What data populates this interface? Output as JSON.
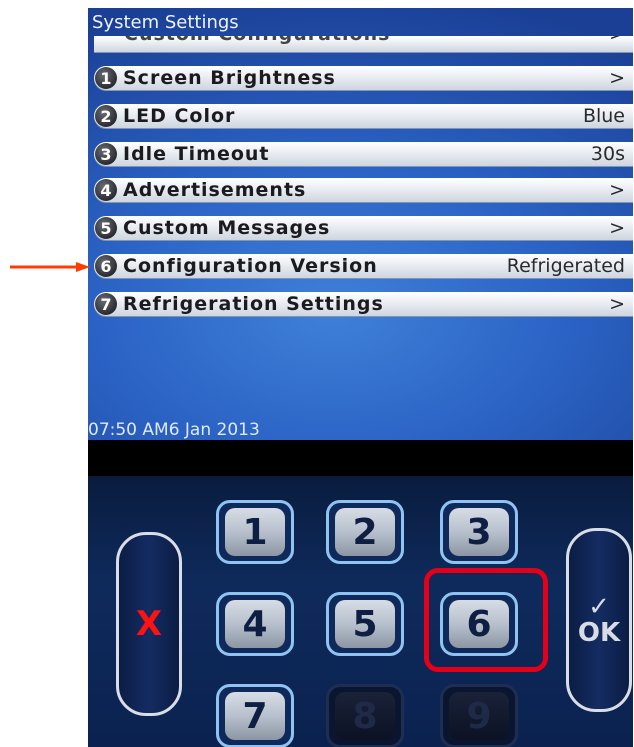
{
  "title": "System Settings",
  "partial_row": {
    "label": "Custom Configurations",
    "value": ">"
  },
  "menu": [
    {
      "num": "1",
      "label": "Screen Brightness",
      "value": ">"
    },
    {
      "num": "2",
      "label": "LED Color",
      "value": "Blue"
    },
    {
      "num": "3",
      "label": "Idle Timeout",
      "value": "30s"
    },
    {
      "num": "4",
      "label": "Advertisements",
      "value": ">"
    },
    {
      "num": "5",
      "label": "Custom Messages",
      "value": ">"
    },
    {
      "num": "6",
      "label": "Configuration Version",
      "value": "Refrigerated"
    },
    {
      "num": "7",
      "label": "Refrigeration Settings",
      "value": ">"
    }
  ],
  "timestamp": "07:50 AM6 Jan 2013",
  "keypad": {
    "keys": [
      "1",
      "2",
      "3",
      "4",
      "5",
      "6",
      "7",
      "8",
      "9"
    ],
    "cancel": "X",
    "ok_check": "✓",
    "ok": "OK"
  },
  "colors": {
    "screen_blue": "#2b63c4",
    "highlight_red": "#e5001a",
    "arrow_orange": "#ff3b00"
  }
}
